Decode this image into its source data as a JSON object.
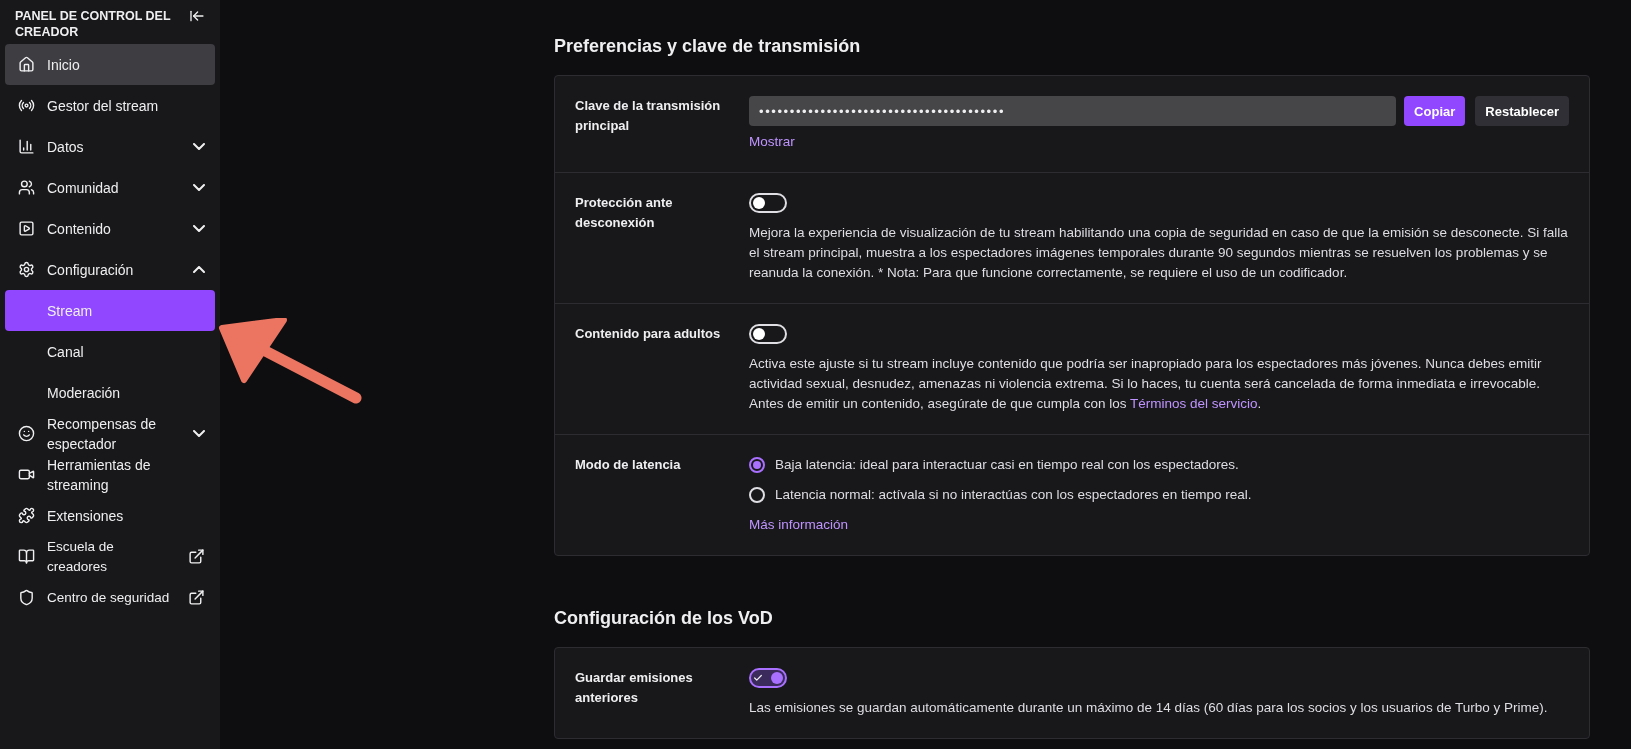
{
  "sidebar": {
    "title": "PANEL DE CONTROL DEL CREADOR",
    "items": [
      {
        "kind": "page",
        "label": "Inicio",
        "hovered": true
      },
      {
        "kind": "page",
        "label": "Gestor del stream",
        "hovered": false
      },
      {
        "kind": "group",
        "label": "Datos",
        "hovered": false,
        "expanded": false
      },
      {
        "kind": "group",
        "label": "Comunidad",
        "hovered": false,
        "expanded": false
      },
      {
        "kind": "group",
        "label": "Contenido",
        "hovered": false,
        "expanded": false
      },
      {
        "kind": "group",
        "label": "Configuración",
        "hovered": false,
        "expanded": true,
        "children": [
          {
            "label": "Stream",
            "selected": true
          },
          {
            "label": "Canal",
            "selected": false
          },
          {
            "label": "Moderación",
            "selected": false
          }
        ]
      },
      {
        "kind": "group",
        "label": "Recompensas de espectador",
        "hovered": false,
        "expanded": false
      },
      {
        "kind": "page",
        "label": "Herramientas de streaming",
        "hovered": false
      },
      {
        "kind": "page",
        "label": "Extensiones",
        "hovered": false
      },
      {
        "kind": "external",
        "label": "Escuela de creadores",
        "hovered": false
      },
      {
        "kind": "external",
        "label": "Centro de seguridad",
        "hovered": false
      }
    ]
  },
  "sections": [
    {
      "title": "Preferencias y clave de transmisión",
      "rows": [
        {
          "kind": "key",
          "label": "Clave de la transmisión principal",
          "value": "••••••••••••••••••••••••••••••••••••••••",
          "buttons": [
            "Copiar",
            "Restablecer"
          ],
          "link": "Mostrar"
        },
        {
          "kind": "toggle",
          "label": "Protección ante desconexión",
          "on": false,
          "description": "Mejora la experiencia de visualización de tu stream habilitando una copia de seguridad en caso de que la emisión se desconecte. Si falla el stream principal, muestra a los espectadores imágenes temporales durante 90 segundos mientras se resuelven los problemas y se reanuda la conexión. * Nota: Para que funcione correctamente, se requiere el uso de un codificador."
        },
        {
          "kind": "toggle",
          "label": "Contenido para adultos",
          "on": false,
          "description": "Activa este ajuste si tu stream incluye contenido que podría ser inapropiado para los espectadores más jóvenes. Nunca debes emitir actividad sexual, desnudez, amenazas ni violencia extrema. Si lo haces, tu cuenta será cancelada de forma inmediata e irrevocable. Antes de emitir un contenido, asegúrate de que cumpla con los",
          "link": "Términos del servicio",
          "after": "."
        },
        {
          "kind": "radio",
          "label": "Modo de latencia",
          "options": [
            {
              "label": "Baja latencia: ideal para interactuar casi en tiempo real con los espectadores.",
              "selected": true
            },
            {
              "label": "Latencia normal: actívala si no interactúas con los espectadores en tiempo real.",
              "selected": false
            }
          ],
          "link": "Más información"
        }
      ]
    },
    {
      "title": "Configuración de los VoD",
      "rows": [
        {
          "kind": "toggle",
          "label": "Guardar emisiones anteriores",
          "on": true,
          "description": "Las emisiones se guardan automáticamente durante un máximo de 14 días (60 días para los socios y los usuarios de Turbo y Prime)."
        }
      ]
    }
  ]
}
